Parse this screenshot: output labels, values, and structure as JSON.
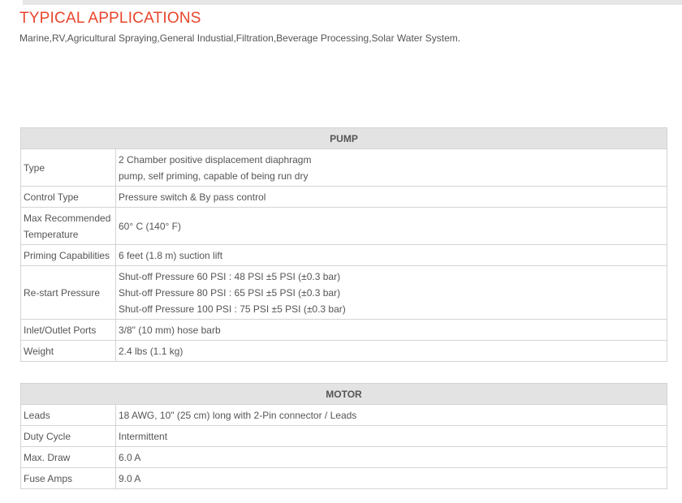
{
  "header": {
    "title": "TYPICAL APPLICATIONS",
    "applications": "Marine,RV,Agricultural Spraying,General Industial,Filtration,Beverage Processing,Solar Water System."
  },
  "pump": {
    "heading": "PUMP",
    "rows": [
      {
        "label": [
          "Type"
        ],
        "value": [
          "2 Chamber positive displacement diaphragm",
          "pump, self priming, capable of being run dry"
        ]
      },
      {
        "label": [
          "Control Type"
        ],
        "value": [
          "Pressure switch & By pass control"
        ]
      },
      {
        "label": [
          "Max Recommended",
          "Temperature"
        ],
        "value": [
          "60° C (140° F)"
        ]
      },
      {
        "label": [
          "Priming Capabilities"
        ],
        "value": [
          "6 feet (1.8 m) suction lift"
        ]
      },
      {
        "label": [
          "Re-start Pressure"
        ],
        "value": [
          "Shut-off Pressure 60 PSI : 48 PSI ±5 PSI (±0.3 bar)",
          "Shut-off Pressure 80 PSI : 65 PSI ±5 PSI (±0.3 bar)",
          "Shut-off Pressure 100 PSI : 75 PSI ±5 PSI (±0.3 bar)"
        ]
      },
      {
        "label": [
          "Inlet/Outlet Ports"
        ],
        "value": [
          "3/8\" (10 mm) hose barb"
        ]
      },
      {
        "label": [
          "Weight"
        ],
        "value": [
          "2.4 lbs (1.1 kg)"
        ]
      }
    ]
  },
  "motor": {
    "heading": "MOTOR",
    "rows": [
      {
        "label": [
          "Leads"
        ],
        "value": [
          "18 AWG, 10\" (25 cm) long with 2-Pin connector / Leads"
        ]
      },
      {
        "label": [
          "Duty Cycle"
        ],
        "value": [
          "Intermittent"
        ]
      },
      {
        "label": [
          "Max. Draw"
        ],
        "value": [
          "6.0 A"
        ]
      },
      {
        "label": [
          "Fuse Amps"
        ],
        "value": [
          "9.0 A"
        ]
      }
    ]
  }
}
